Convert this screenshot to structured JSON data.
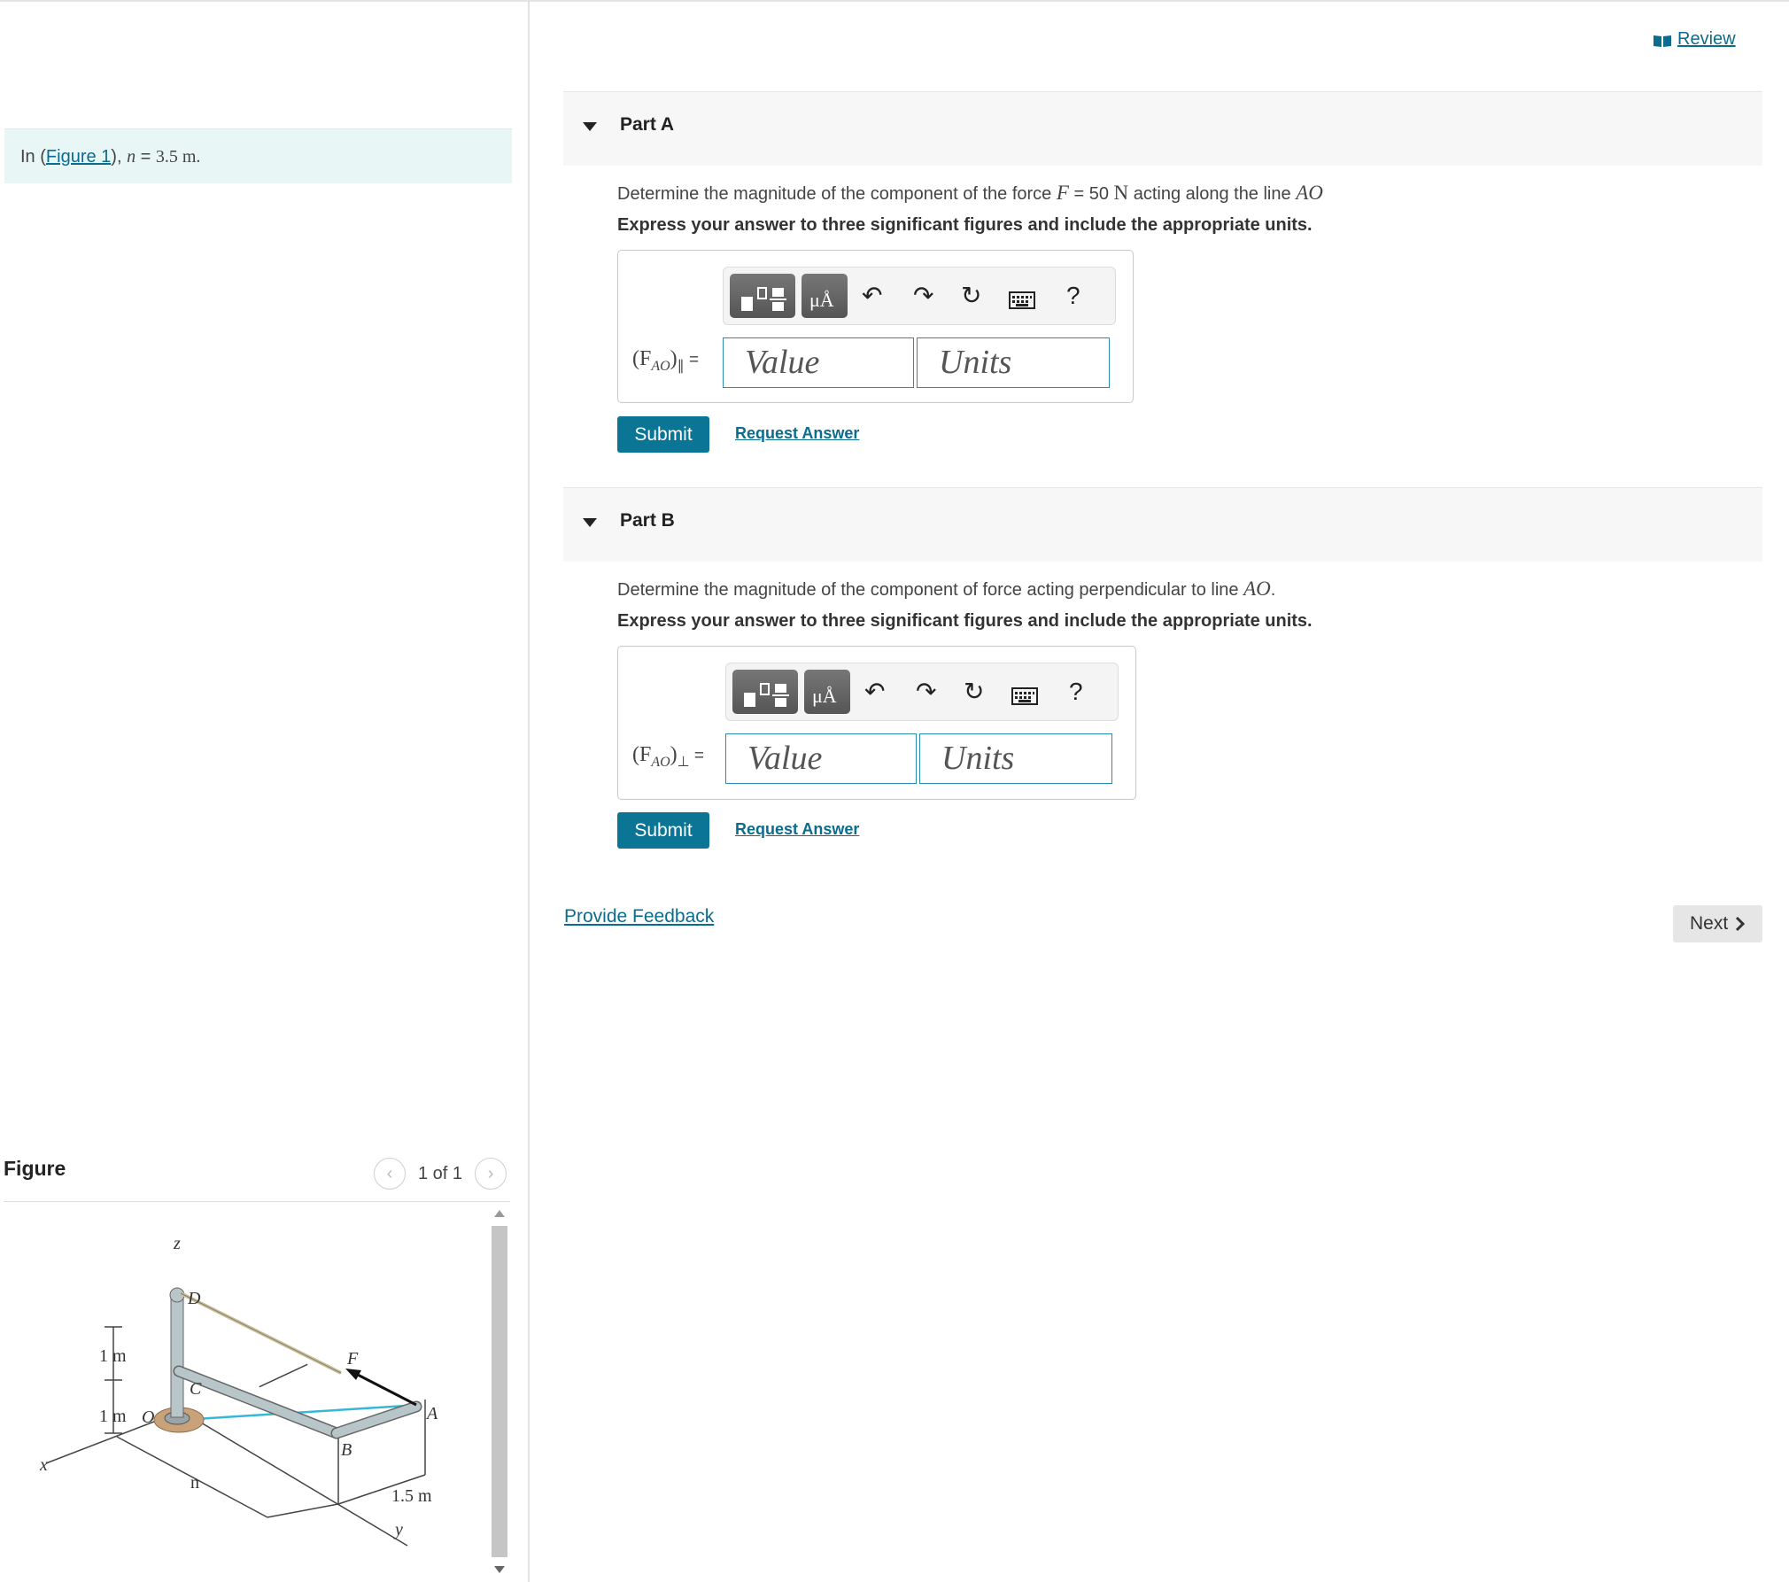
{
  "intro": {
    "prefix": "In (",
    "figure_link": "Figure 1",
    "suffix": "), ",
    "var": "n",
    "eq": " = ",
    "value": "3.5 m",
    "period": "."
  },
  "review_link": "Review",
  "parts": [
    {
      "label": "Part A",
      "question_pre": "Determine the magnitude of the component of the force ",
      "force_var": "F",
      "force_eq": " = 50 ",
      "force_unit": "N",
      "question_post": " acting along the line ",
      "line": "AO",
      "instruction": "Express your answer to three significant figures and include the appropriate units.",
      "eq_main": "(F",
      "eq_sub": "AO",
      "eq_close": ")",
      "eq_symbol": "∥",
      "eq_equals": " =",
      "value_placeholder": "Value",
      "units_placeholder": "Units",
      "submit": "Submit",
      "request_answer": "Request Answer"
    },
    {
      "label": "Part B",
      "question_pre": "Determine the magnitude of the component of force acting perpendicular to line ",
      "line": "AO",
      "question_post": ".",
      "instruction": "Express your answer to three significant figures and include the appropriate units.",
      "eq_main": "(F",
      "eq_sub": "AO",
      "eq_close": ")",
      "eq_symbol": "⊥",
      "eq_equals": " =",
      "value_placeholder": "Value",
      "units_placeholder": "Units",
      "submit": "Submit",
      "request_answer": "Request Answer"
    }
  ],
  "toolbar": {
    "units_icon_text": "μÅ",
    "help": "?",
    "undo": "↶",
    "redo": "↷",
    "reset": "↻"
  },
  "figure": {
    "title": "Figure",
    "pager": "1 of 1",
    "labels": {
      "z": "z",
      "x": "x",
      "y": "y",
      "D": "D",
      "C": "C",
      "O": "O",
      "B": "B",
      "A": "A",
      "F": "F",
      "n": "n",
      "dim1": "1 m",
      "dim2": "1 m",
      "dim3": "1.5 m"
    }
  },
  "feedback_link": "Provide Feedback",
  "next_button": "Next",
  "colors": {
    "link": "#0b6c8e",
    "submit_bg": "#0b7596",
    "intro_bg": "#e9f6f6",
    "field_border": "#2a8cb0"
  }
}
